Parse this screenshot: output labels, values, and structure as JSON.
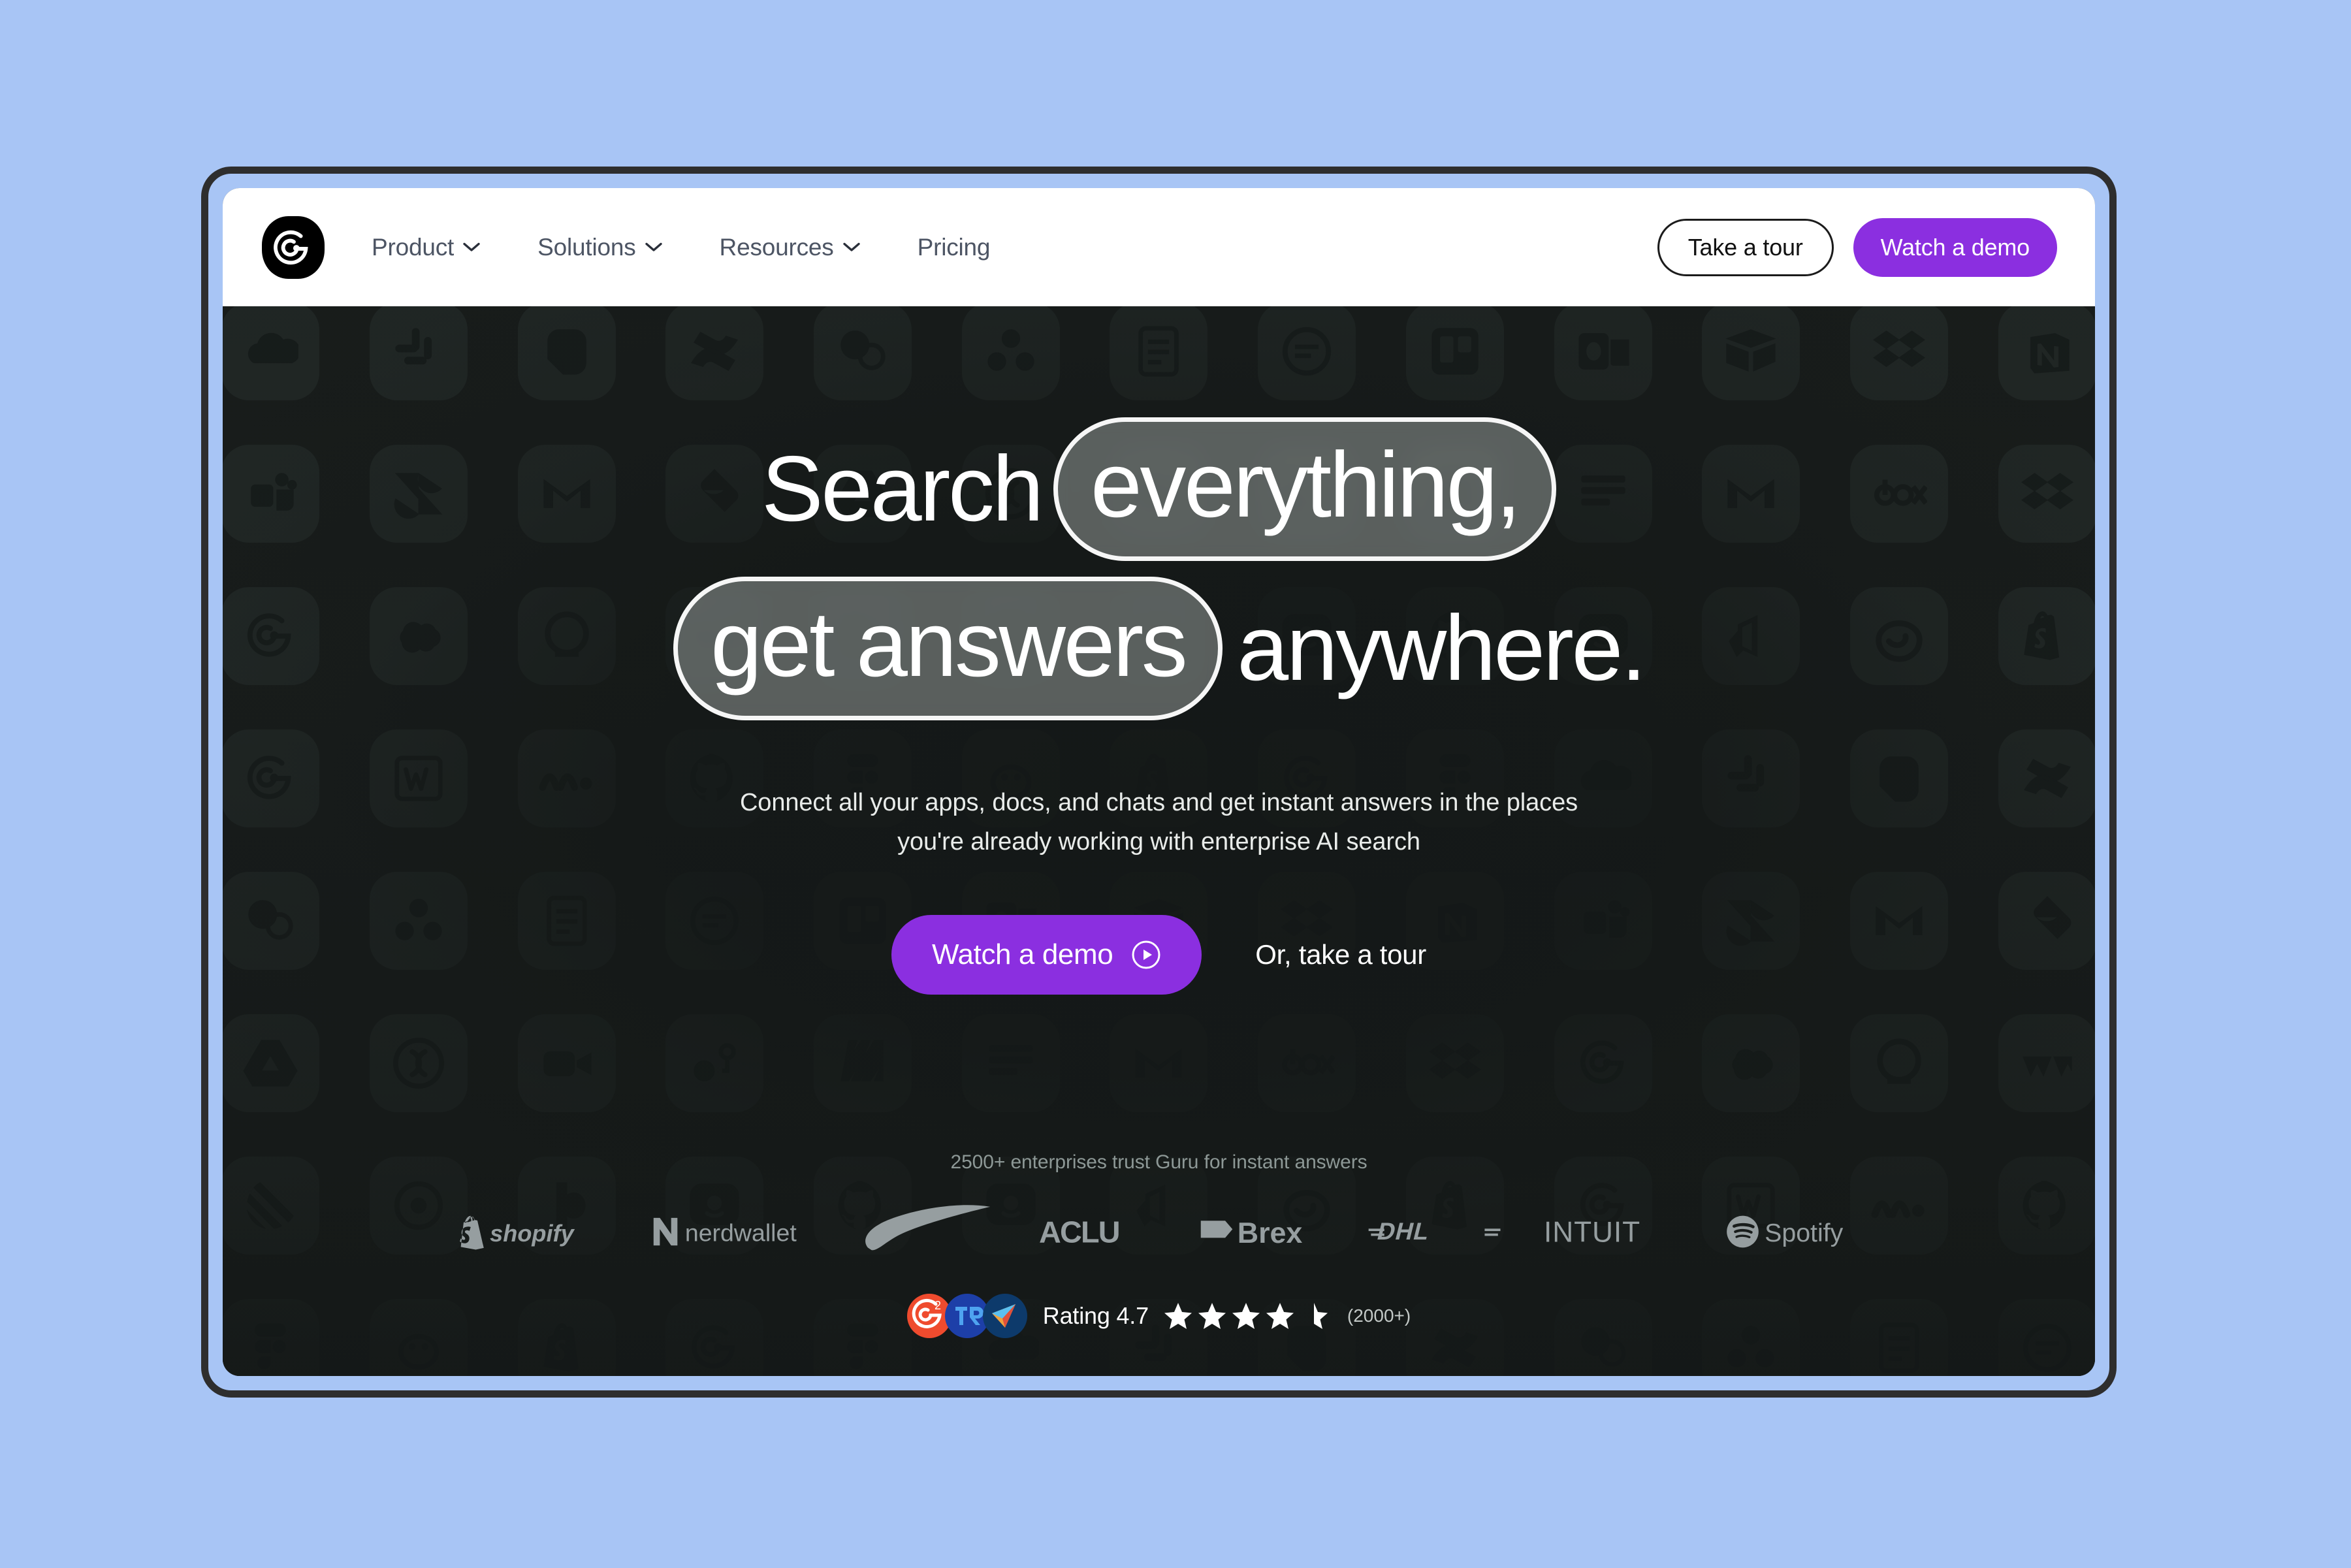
{
  "page": {
    "background_color": "#a8c5f5",
    "frame_border_color": "#2e2e2e",
    "accent_color": "#8b2fe0",
    "hero_background_color": "#191d1c"
  },
  "nav": {
    "logo_name": "guru-logo",
    "links": [
      {
        "label": "Product",
        "has_dropdown": true,
        "icon": "chevron-down-icon"
      },
      {
        "label": "Solutions",
        "has_dropdown": true,
        "icon": "chevron-down-icon"
      },
      {
        "label": "Resources",
        "has_dropdown": true,
        "icon": "chevron-down-icon"
      },
      {
        "label": "Pricing",
        "has_dropdown": false,
        "icon": ""
      }
    ],
    "take_tour_label": "Take a tour",
    "watch_demo_label": "Watch a demo"
  },
  "hero": {
    "headline": {
      "line1_plain": "Search",
      "line1_pill": "everything,",
      "line2_pill": "get answers",
      "line2_plain": "anywhere."
    },
    "subtitle": "Connect all your apps, docs, and chats and get instant answers in the places you're already working with enterprise AI search",
    "cta_primary_label": "Watch a demo",
    "cta_primary_icon": "play-circle-icon",
    "cta_secondary_label": "Or, take a tour"
  },
  "social_proof": {
    "trust_line": "2500+ enterprises trust Guru for instant answers",
    "logos": [
      {
        "name": "shopify-logo",
        "label": "shopify"
      },
      {
        "name": "nerdwallet-logo",
        "label": "nerdwallet"
      },
      {
        "name": "nike-logo",
        "label": "Nike"
      },
      {
        "name": "aclu-logo",
        "label": "ACLU"
      },
      {
        "name": "brex-logo",
        "label": "Brex"
      },
      {
        "name": "dhl-logo",
        "label": "DHL"
      },
      {
        "name": "intuit-logo",
        "label": "INTUIT"
      },
      {
        "name": "spotify-logo",
        "label": "Spotify"
      }
    ],
    "rating": {
      "badges": [
        "g2-badge-icon",
        "trustradius-badge-icon",
        "capterra-badge-icon"
      ],
      "label": "Rating 4.7",
      "value": 4.7,
      "max": 5,
      "count_label": "(2000+)"
    }
  },
  "background_icons": [
    "onedrive-icon",
    "slack-icon",
    "evernote-icon",
    "confluence-icon",
    "sharepoint-icon",
    "asana-icon",
    "dropbox-paper-icon",
    "quip-icon",
    "trello-icon",
    "outlook-icon",
    "airtable-icon",
    "dropbox-icon",
    "notion-icon",
    "teams-icon",
    "zendesk-icon",
    "gmail-icon",
    "jira-icon",
    "google-drive-icon",
    "quickbooks-icon",
    "zoom-icon",
    "hubspot-icon",
    "miro-icon",
    "smartsheet-icon",
    "gmail-icon",
    "box-icon",
    "dropbox-icon",
    "guru-icon",
    "salesforce-icon",
    "servicenow-icon",
    "workday-icon",
    "linear-icon",
    "loom-icon",
    "pipedrive-icon",
    "intercom-icon",
    "github-icon",
    "intercom-icon",
    "azure-devops-icon",
    "basecamp-icon",
    "shopify-icon",
    "guru-icon",
    "word-icon",
    "monday-icon",
    "github-icon",
    "figma-icon",
    "mailchimp-icon",
    "shopify-icon",
    "guru-icon",
    "figma-icon"
  ]
}
